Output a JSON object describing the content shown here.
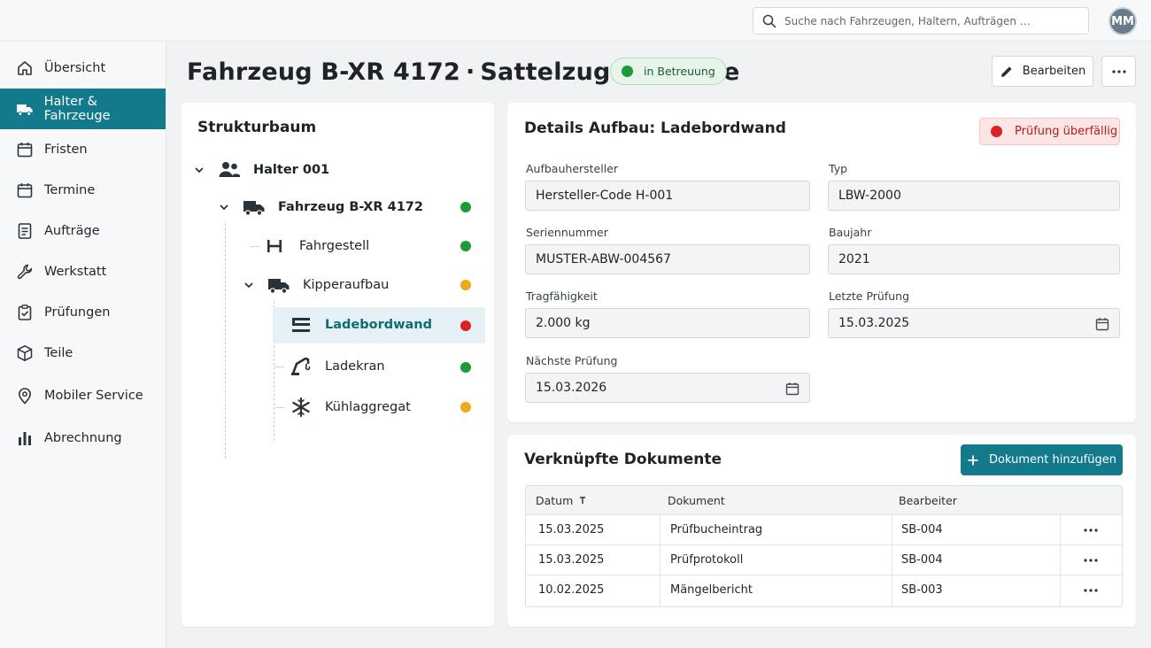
{
  "search": {
    "placeholder": "Suche nach Fahrzeugen, Haltern, Aufträgen …"
  },
  "user": {
    "initials": "MM"
  },
  "sidebar": {
    "items": [
      {
        "label": "Übersicht",
        "icon": "home-icon"
      },
      {
        "label": "Halter & Fahrzeuge",
        "icon": "truck-icon",
        "active": true
      },
      {
        "label": "Fristen",
        "icon": "calendar-icon"
      },
      {
        "label": "Termine",
        "icon": "calendar-icon"
      },
      {
        "label": "Aufträge",
        "icon": "document-icon"
      },
      {
        "label": "Werkstatt",
        "icon": "wrench-icon"
      },
      {
        "label": "Prüfungen",
        "icon": "clipboard-check-icon"
      },
      {
        "label": "Teile",
        "icon": "box-icon"
      },
      {
        "label": "Mobiler Service",
        "icon": "map-pin-icon"
      },
      {
        "label": "Abrechnung",
        "icon": "bar-chart-icon"
      }
    ]
  },
  "header": {
    "title": "Fahrzeug B-XR 4172",
    "separator": "·",
    "subtitle": "Sattelzugmaschine",
    "status": "in Betreuung",
    "edit_label": "Bearbeiten"
  },
  "tree": {
    "title": "Strukturbaum",
    "nodes": [
      {
        "label": "Halter 001",
        "icon": "users-icon",
        "status": null
      },
      {
        "label": "Fahrzeug B-XR 4172",
        "icon": "truck-icon",
        "status": "green"
      },
      {
        "label": "Fahrgestell",
        "icon": "chassis-icon",
        "status": "green"
      },
      {
        "label": "Kipperaufbau",
        "icon": "truck-icon",
        "status": "yellow"
      },
      {
        "label": "Ladebordwand",
        "icon": "tail-lift-icon",
        "status": "red",
        "selected": true
      },
      {
        "label": "Ladekran",
        "icon": "crane-icon",
        "status": "green"
      },
      {
        "label": "Kühlaggregat",
        "icon": "snowflake-icon",
        "status": "yellow"
      }
    ]
  },
  "details": {
    "title": "Details Aufbau: Ladebordwand",
    "badge": "Prüfung überfällig",
    "fields": {
      "manufacturer": {
        "label": "Aufbauhersteller",
        "value": "Hersteller-Code H-001"
      },
      "type": {
        "label": "Typ",
        "value": "LBW-2000"
      },
      "serial": {
        "label": "Seriennummer",
        "value": "MUSTER-ABW-004567"
      },
      "year": {
        "label": "Baujahr",
        "value": "2021"
      },
      "capacity": {
        "label": "Tragfähigkeit",
        "value": "2.000 kg"
      },
      "last_check": {
        "label": "Letzte Prüfung",
        "value": "15.03.2025"
      },
      "next_check": {
        "label": "Nächste Prüfung",
        "value": "15.03.2026"
      }
    }
  },
  "documents": {
    "title": "Verknüpfte Dokumente",
    "add_label": "Dokument hinzufügen",
    "columns": {
      "date": "Datum",
      "sort_icon": "sort-icon",
      "document": "Dokument",
      "editor": "Bearbeiter"
    },
    "rows": [
      {
        "date": "15.03.2025",
        "document": "Prüfbucheintrag",
        "editor": "SB-004"
      },
      {
        "date": "15.03.2025",
        "document": "Prüfprotokoll",
        "editor": "SB-004"
      },
      {
        "date": "10.02.2025",
        "document": "Mängelbericht",
        "editor": "SB-003"
      }
    ]
  },
  "colors": {
    "accent": "#127a8a",
    "status_green": "#1e9a3a",
    "status_yellow": "#f0a81c",
    "status_red": "#d72323"
  }
}
